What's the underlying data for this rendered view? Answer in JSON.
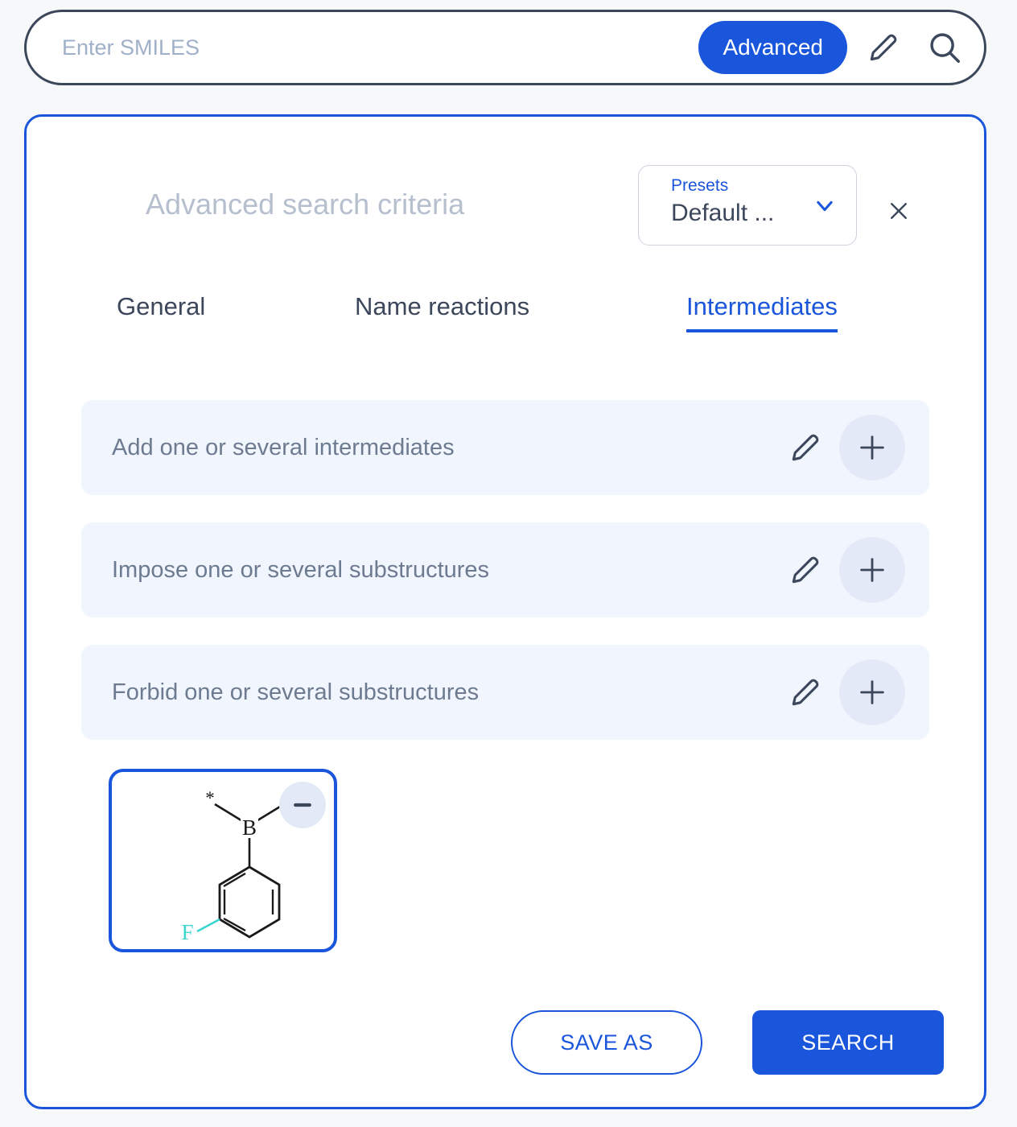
{
  "colors": {
    "accent": "#1a56db",
    "dark": "#3c475c",
    "muted": "#6d7b91",
    "title_gray": "#b6bfce",
    "row_bg": "#f1f5fd",
    "circle_bg": "#e3e9f6",
    "page_bg": "#f7f8fa",
    "fluorine": "#3ad6d0"
  },
  "search": {
    "placeholder": "Enter SMILES",
    "value": "",
    "advanced_label": "Advanced",
    "edit_icon": "pencil-icon",
    "search_icon": "search-icon"
  },
  "panel": {
    "title": "Advanced search criteria",
    "close_icon": "close-icon",
    "presets": {
      "label": "Presets",
      "value": "Default ...",
      "chevron_icon": "chevron-down-icon"
    },
    "tabs": [
      {
        "label": "General",
        "active": false
      },
      {
        "label": "Name reactions",
        "active": false
      },
      {
        "label": "Intermediates",
        "active": true
      }
    ],
    "criteria_rows": [
      {
        "label": "Add one or several intermediates",
        "edit_icon": "pencil-icon",
        "add_icon": "plus-icon"
      },
      {
        "label": "Impose one or several substructures",
        "edit_icon": "pencil-icon",
        "add_icon": "plus-icon"
      },
      {
        "label": "Forbid one or several substructures",
        "edit_icon": "pencil-icon",
        "add_icon": "plus-icon"
      }
    ],
    "molecule_card": {
      "atom_labels": [
        "*",
        "*",
        "B",
        "F"
      ],
      "remove_icon": "minus-icon",
      "alt": "3-fluorophenyl boron with two attachment points"
    },
    "footer": {
      "save_as_label": "SAVE AS",
      "search_label": "SEARCH"
    }
  }
}
